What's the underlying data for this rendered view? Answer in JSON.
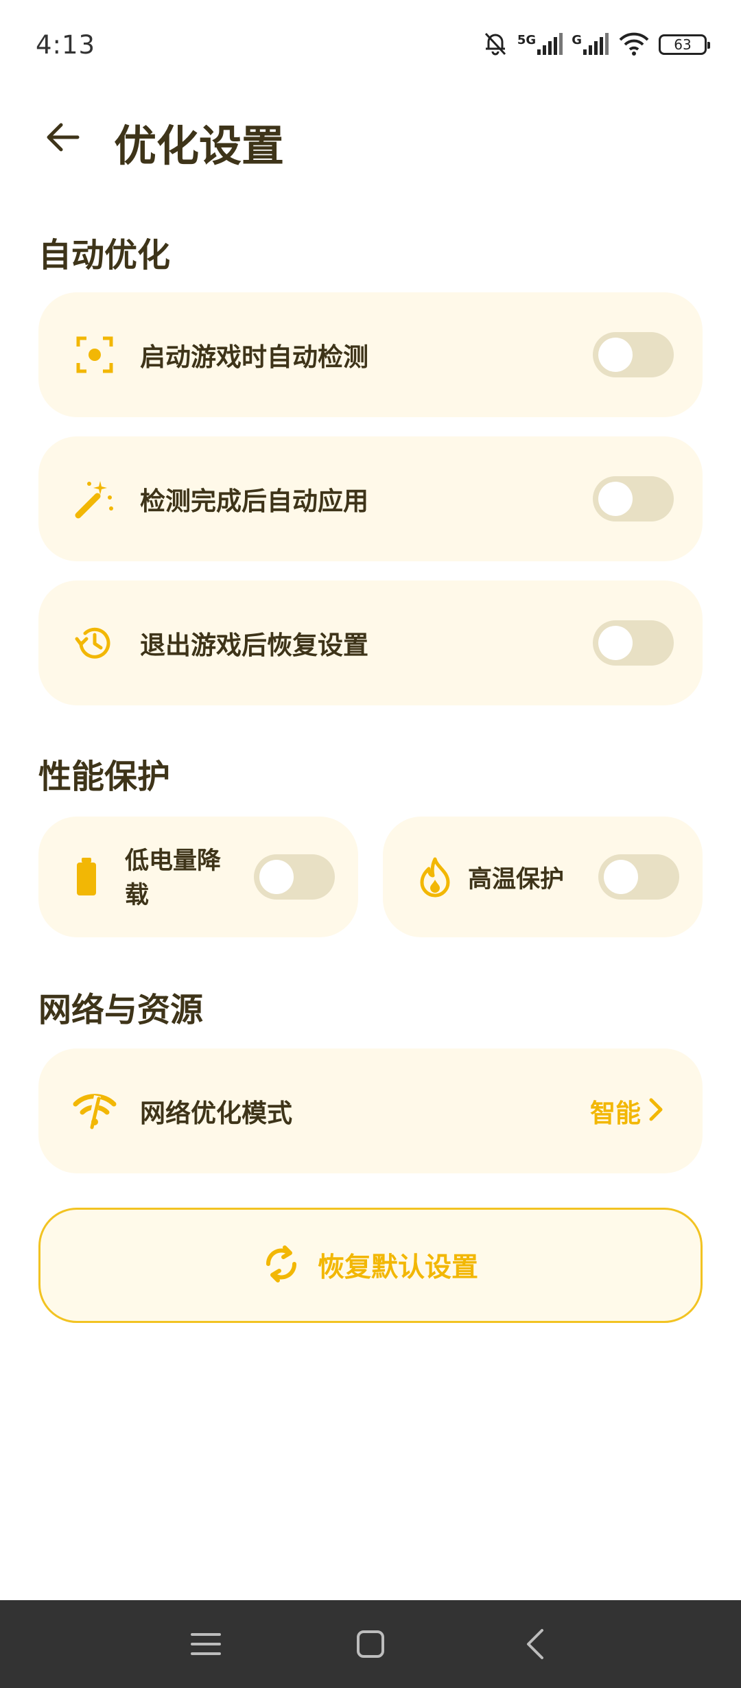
{
  "status_bar": {
    "time": "4:13",
    "signal_1_label": "5G",
    "signal_2_label": "G",
    "battery_level": "63"
  },
  "header": {
    "title": "优化设置"
  },
  "sections": {
    "auto": {
      "title": "自动优化",
      "items": [
        {
          "label": "启动游戏时自动检测",
          "icon": "focus-scan-icon",
          "enabled": false
        },
        {
          "label": "检测完成后自动应用",
          "icon": "magic-wand-icon",
          "enabled": false
        },
        {
          "label": "退出游戏后恢复设置",
          "icon": "history-icon",
          "enabled": false
        }
      ]
    },
    "perf": {
      "title": "性能保护",
      "items": [
        {
          "label_line1": "低电量降",
          "label_line2": "载",
          "icon": "battery-icon",
          "enabled": false
        },
        {
          "label": "高温保护",
          "icon": "flame-icon",
          "enabled": false
        }
      ]
    },
    "network": {
      "title": "网络与资源",
      "item": {
        "label": "网络优化模式",
        "value": "智能",
        "icon": "wifi-off-icon"
      }
    }
  },
  "reset_button": {
    "label": "恢复默认设置",
    "icon": "refresh-icon"
  },
  "colors": {
    "accent": "#F2B705",
    "card_bg": "#FFF9E9",
    "text": "#3E3419",
    "toggle_off": "#E8E0C4"
  }
}
